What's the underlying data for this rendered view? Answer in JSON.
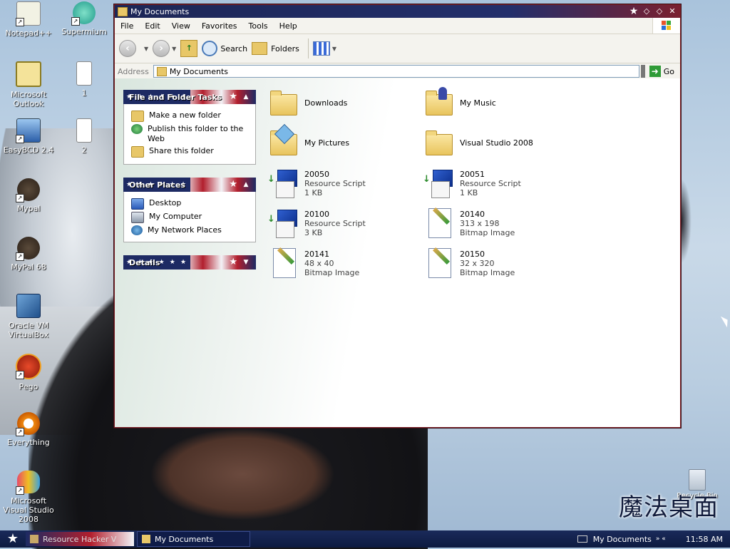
{
  "desktop": {
    "icons": [
      {
        "label": "Notepad++"
      },
      {
        "label": "Supermium"
      },
      {
        "label": "Microsoft Outlook"
      },
      {
        "label": "1"
      },
      {
        "label": "EasyBCD 2.4"
      },
      {
        "label": "2"
      },
      {
        "label": "Mypal"
      },
      {
        "label": "MyPal 68"
      },
      {
        "label": "Oracle VM VirtualBox"
      },
      {
        "label": "Pego"
      },
      {
        "label": "Everything"
      },
      {
        "label": "Microsoft Visual Studio 2008"
      }
    ],
    "recycle_bin": "Recycle Bin",
    "watermark": "魔法桌面"
  },
  "window": {
    "title": "My Documents",
    "menu": [
      "File",
      "Edit",
      "View",
      "Favorites",
      "Tools",
      "Help"
    ],
    "toolbar": {
      "back": "",
      "forward": "",
      "search": "Search",
      "folders": "Folders"
    },
    "address": {
      "label": "Address",
      "value": "My Documents",
      "go": "Go"
    },
    "panels": {
      "file_folder_tasks": {
        "title": "File and Folder Tasks",
        "items": [
          "Make a new folder",
          "Publish this folder to the Web",
          "Share this folder"
        ]
      },
      "other_places": {
        "title": "Other Places",
        "items": [
          "Desktop",
          "My Computer",
          "My Network Places"
        ]
      },
      "details": {
        "title": "Details"
      }
    },
    "files": [
      {
        "name": "Downloads",
        "line2": "",
        "line3": "",
        "kind": "folder"
      },
      {
        "name": "My Music",
        "line2": "",
        "line3": "",
        "kind": "music-folder"
      },
      {
        "name": "My Pictures",
        "line2": "",
        "line3": "",
        "kind": "pictures-folder"
      },
      {
        "name": "Visual Studio 2008",
        "line2": "",
        "line3": "",
        "kind": "folder"
      },
      {
        "name": "20050",
        "line2": "Resource Script",
        "line3": "1 KB",
        "kind": "resource-script"
      },
      {
        "name": "20051",
        "line2": "Resource Script",
        "line3": "1 KB",
        "kind": "resource-script"
      },
      {
        "name": "20100",
        "line2": "Resource Script",
        "line3": "3 KB",
        "kind": "resource-script"
      },
      {
        "name": "20140",
        "line2": "313 x 198",
        "line3": "Bitmap Image",
        "kind": "bitmap"
      },
      {
        "name": "20141",
        "line2": "48 x 40",
        "line3": "Bitmap Image",
        "kind": "bitmap"
      },
      {
        "name": "20150",
        "line2": "32 x 320",
        "line3": "Bitmap Image",
        "kind": "bitmap"
      }
    ]
  },
  "taskbar": {
    "tasks": [
      {
        "label": "Resource Hacker V",
        "active": false
      },
      {
        "label": "My Documents",
        "active": true
      }
    ],
    "tray_label": "My Documents",
    "clock": "11:58 AM"
  },
  "colors": {
    "title_blue": "#1c2656",
    "title_red": "#7a2030",
    "panel_blue": "#1d2a63",
    "panel_red": "#b21f2d",
    "taskbar": "#0d1a40"
  }
}
